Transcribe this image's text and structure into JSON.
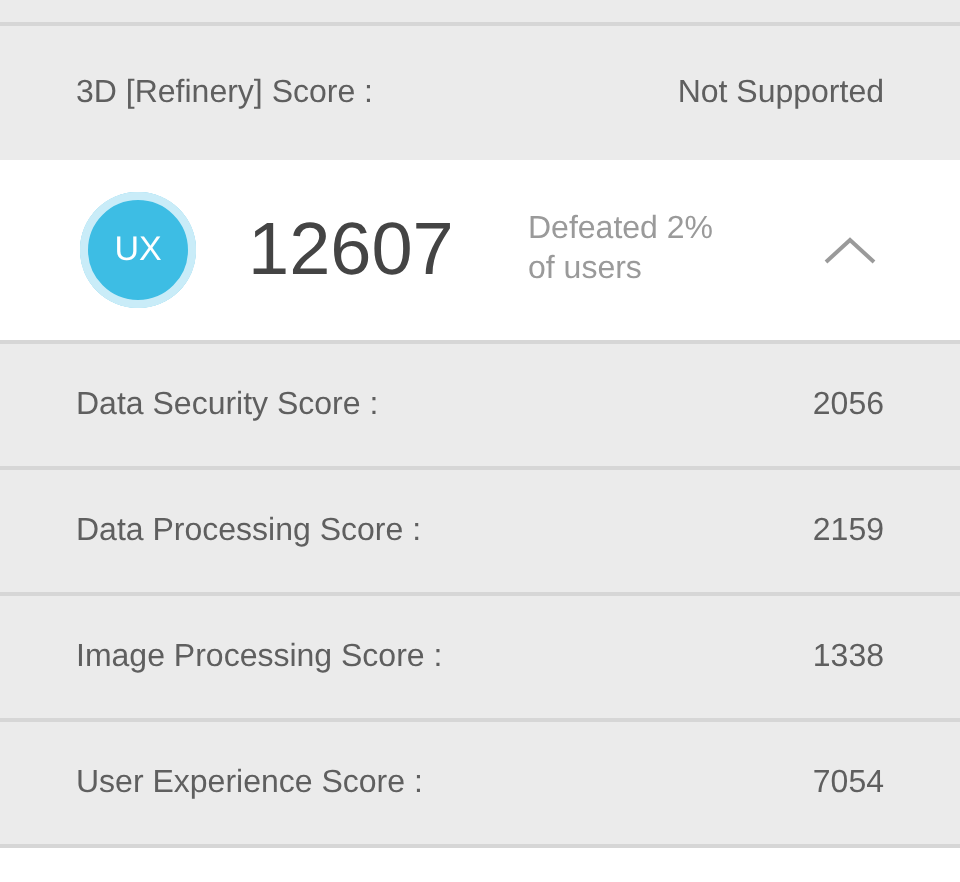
{
  "top_row": {
    "label": "3D [Refinery] Score :",
    "value": "Not Supported"
  },
  "summary": {
    "badge": "UX",
    "score": "12607",
    "note": "Defeated 2% of users",
    "expanded": true
  },
  "details": [
    {
      "label": "Data Security Score :",
      "value": "2056"
    },
    {
      "label": "Data Processing Score :",
      "value": "2159"
    },
    {
      "label": "Image Processing Score :",
      "value": "1338"
    },
    {
      "label": "User Experience Score :",
      "value": "7054"
    }
  ]
}
